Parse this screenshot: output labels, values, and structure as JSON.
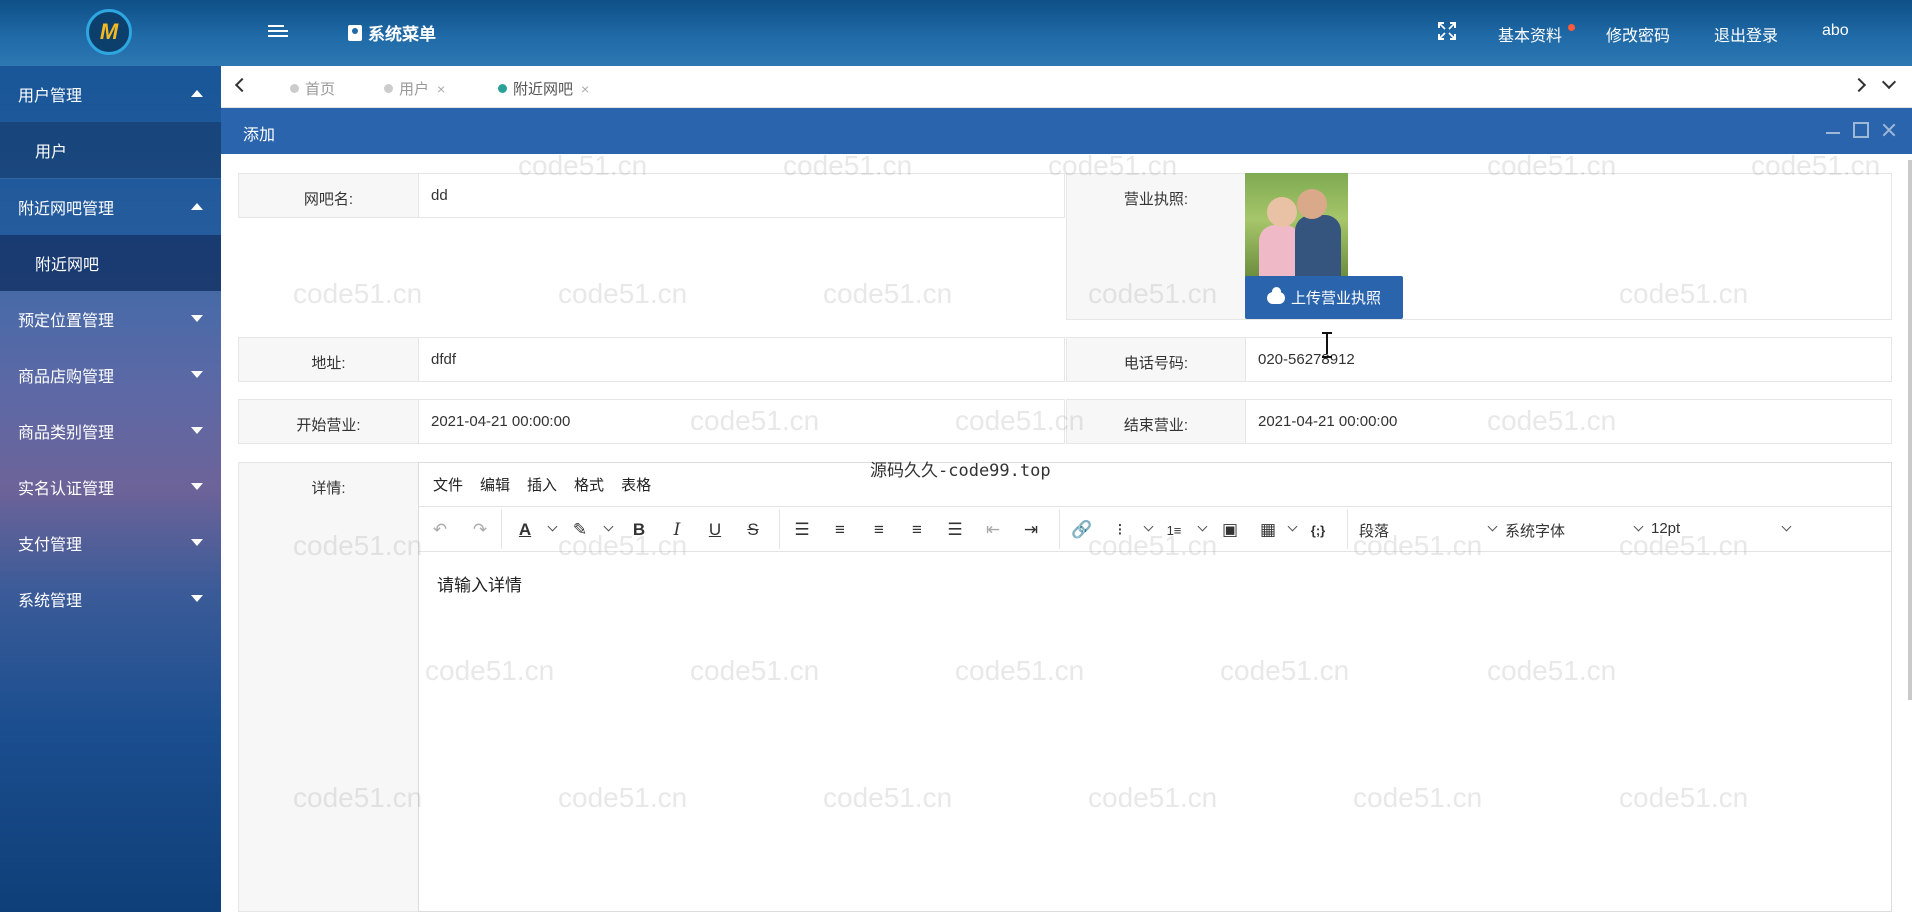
{
  "header": {
    "logo_text": "M",
    "menu_title": "系统菜单",
    "links": {
      "profile": "基本资料",
      "change_password": "修改密码",
      "logout": "退出登录",
      "username": "abo"
    }
  },
  "sidebar": {
    "items": [
      {
        "label": "用户管理"
      },
      {
        "label": "用户"
      },
      {
        "label": "附近网吧管理"
      },
      {
        "label": "附近网吧"
      },
      {
        "label": "预定位置管理"
      },
      {
        "label": "商品店购管理"
      },
      {
        "label": "商品类别管理"
      },
      {
        "label": "实名认证管理"
      },
      {
        "label": "支付管理"
      },
      {
        "label": "系统管理"
      }
    ]
  },
  "tabs": [
    {
      "label": "首页"
    },
    {
      "label": "用户"
    },
    {
      "label": "附近网吧"
    }
  ],
  "dialog": {
    "title": "添加"
  },
  "form": {
    "name": {
      "label": "网吧名:",
      "value": "dd"
    },
    "license": {
      "label": "营业执照:",
      "upload_label": "上传营业执照"
    },
    "address": {
      "label": "地址:",
      "value": "dfdf"
    },
    "phone": {
      "label": "电话号码:",
      "value": "020-56278912"
    },
    "start": {
      "label": "开始营业:",
      "value": "2021-04-21 00:00:00"
    },
    "end": {
      "label": "结束营业:",
      "value": "2021-04-21 00:00:00"
    },
    "details": {
      "label": "详情:"
    }
  },
  "editor": {
    "menu": [
      "文件",
      "编辑",
      "插入",
      "格式",
      "表格"
    ],
    "block_format": "段落",
    "font_family": "系统字体",
    "font_size": "12pt",
    "placeholder": "请输入详情"
  },
  "overlay_text": "源码久久-code99.top",
  "watermark": "code51.cn",
  "colors": {
    "primary": "#2a64ad",
    "header": "#1f6aa7",
    "active_tab_dot": "#2aa198",
    "notify_dot": "#ff5a3c"
  }
}
